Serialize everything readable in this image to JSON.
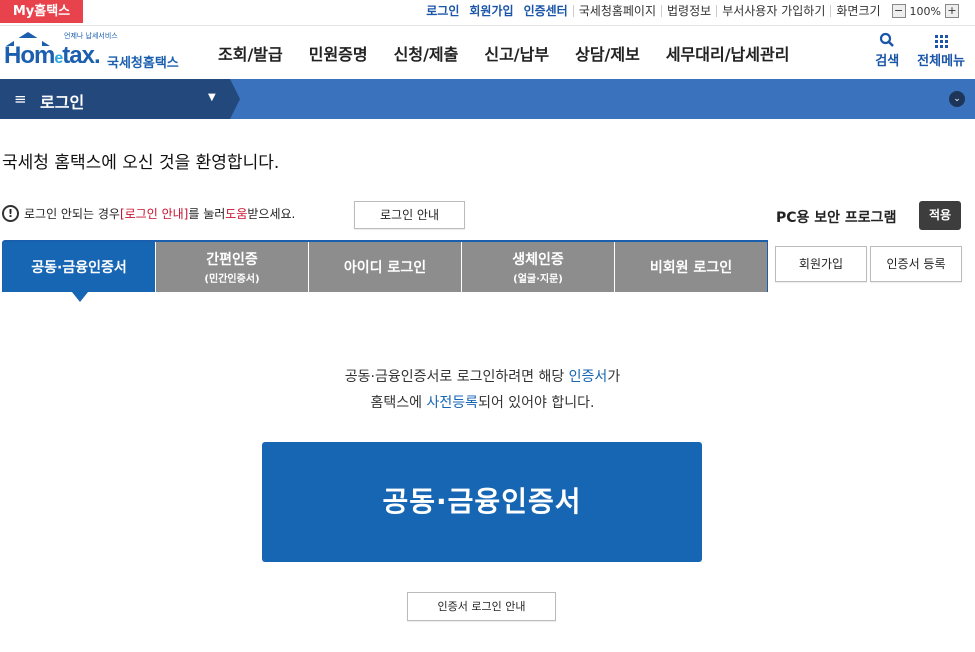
{
  "topbar": {
    "my_hometax": "My홈택스",
    "links_blue": [
      "로그인",
      "회원가입",
      "인증센터"
    ],
    "links_plain": [
      "국세청홈페이지",
      "법령정보",
      "부서사용자 가입하기"
    ],
    "screen_size_label": "화면크기",
    "zoom_minus": "−",
    "zoom_value": "100%",
    "zoom_plus": "+"
  },
  "header": {
    "logo_tagline": "언제나 납세서비스",
    "logo_word_a": "Hom",
    "logo_word_e": "e",
    "logo_word_b": "tax.",
    "logo_korean": "국세청홈택스",
    "gnb": [
      "조회/발급",
      "민원증명",
      "신청/제출",
      "신고/납부",
      "상담/제보",
      "세무대리/납세관리"
    ],
    "search_label": "검색",
    "all_menu_label": "전체메뉴"
  },
  "navbar": {
    "hamburger": "≡",
    "title": "로그인",
    "caret": "▼",
    "expand": "⌄"
  },
  "main": {
    "welcome": "국세청 홈택스에 오신 것을 환영합니다.",
    "notice_warn": "!",
    "notice_pre": "로그인 안되는 경우 ",
    "notice_red1": "[로그인 안내]",
    "notice_mid": "를 눌러 ",
    "notice_red2": "도움",
    "notice_post": "받으세요.",
    "login_guide_btn": "로그인 안내",
    "pc_security_label": "PC용 보안 프로그램",
    "apply_btn": "적용",
    "tabs": [
      {
        "label": "공동·금융인증서",
        "sub": ""
      },
      {
        "label": "간편인증",
        "sub": "(민간인증서)"
      },
      {
        "label": "아이디 로그인",
        "sub": ""
      },
      {
        "label": "생체인증",
        "sub": "(얼굴·지문)"
      },
      {
        "label": "비회원 로그인",
        "sub": ""
      }
    ],
    "join_btn": "회원가입",
    "cert_register_btn": "인증서 등록",
    "desc_line1_pre": "공동·금융인증서로 로그인하려면 해당 ",
    "desc_line1_blue": "인증서",
    "desc_line1_post": "가",
    "desc_line2_pre": "홈택스에 ",
    "desc_line2_blue": "사전등록",
    "desc_line2_post": "되어 있어야 합니다.",
    "cert_big_button": "공동·금융인증서",
    "cert_login_guide_btn": "인증서 로그인 안내"
  },
  "colors": {
    "brand_blue": "#1766b4",
    "nav_dark": "#23487c",
    "nav_bar": "#3a72bd",
    "tab_gray": "#8d8d8d",
    "badge_red": "#e8424d",
    "notice_red": "#c8102e"
  },
  "icons": {
    "search": "search-icon",
    "all_menu": "grid-icon",
    "warning": "exclamation-circle-icon"
  }
}
